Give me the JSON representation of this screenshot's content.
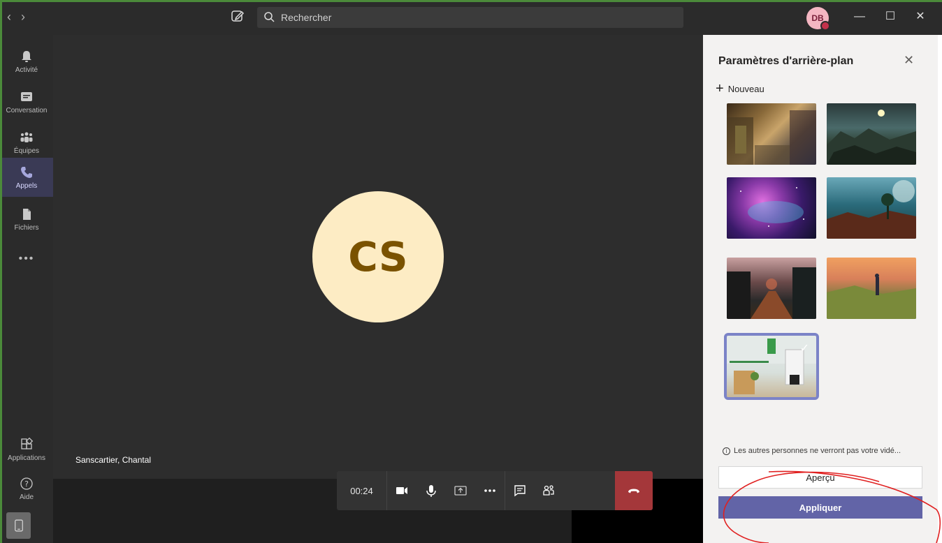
{
  "search": {
    "placeholder": "Rechercher"
  },
  "user": {
    "initials": "DB"
  },
  "rail": [
    {
      "label": "Activité"
    },
    {
      "label": "Conversation"
    },
    {
      "label": "Équipes"
    },
    {
      "label": "Appels"
    },
    {
      "label": "Fichiers"
    }
  ],
  "rail_more": "•••",
  "rail_bottom": [
    {
      "label": "Applications"
    },
    {
      "label": "Aide"
    }
  ],
  "call": {
    "participant_initials": "CS",
    "participant_name": "Sanscartier, Chantal",
    "timer": "00:24"
  },
  "panel": {
    "title": "Paramètres d'arrière-plan",
    "new_label": "Nouveau",
    "info_text": "Les autres personnes ne verront pas votre vidé...",
    "preview_label": "Aperçu",
    "apply_label": "Appliquer"
  },
  "colors": {
    "accent": "#6264a7",
    "hangup": "#a4373a",
    "avatar_bg": "#fdecc4"
  }
}
